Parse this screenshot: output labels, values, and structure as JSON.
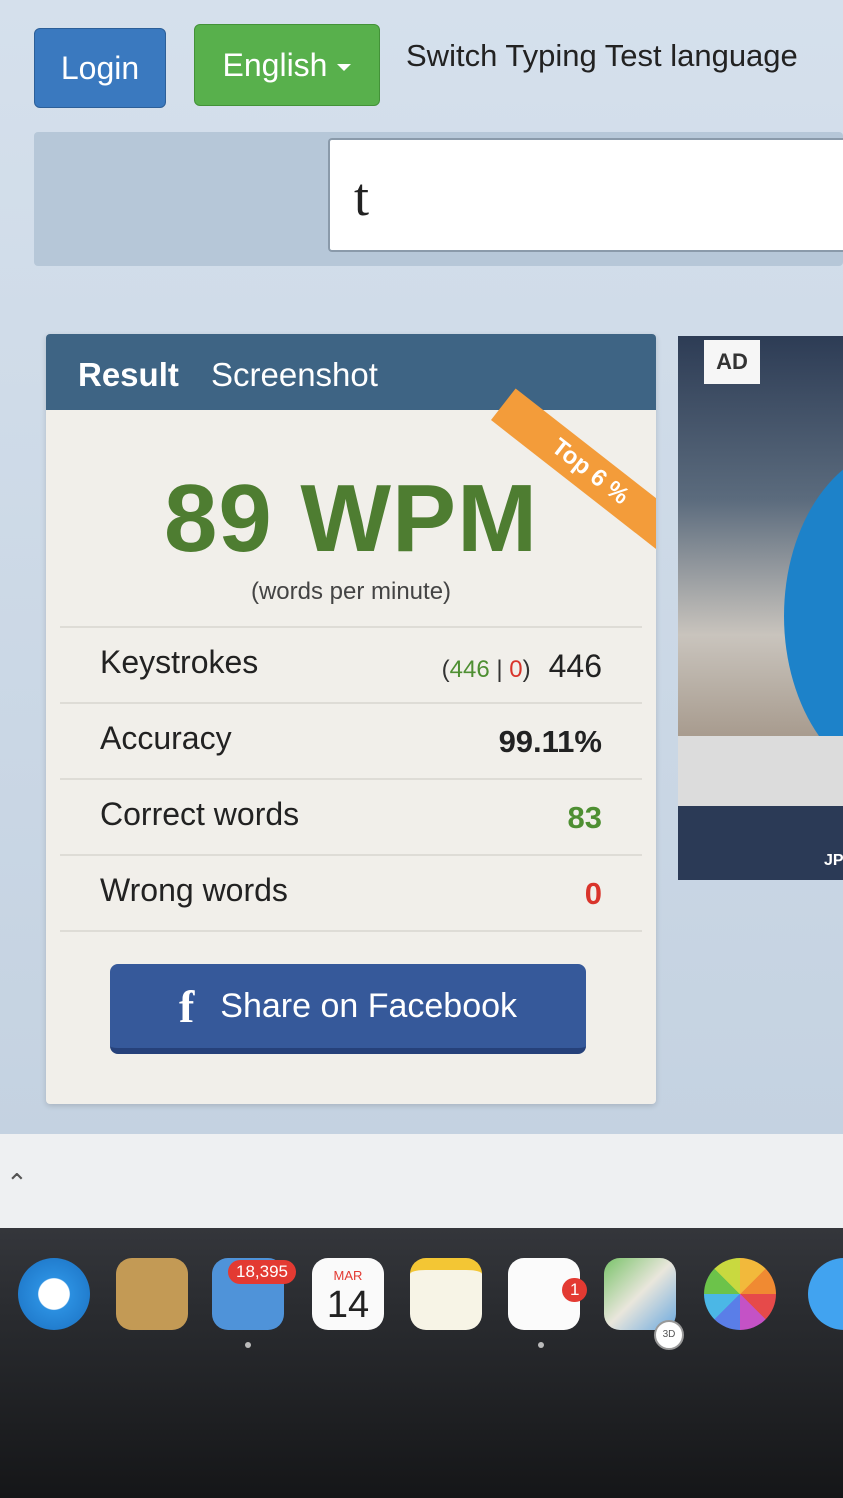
{
  "topbar": {
    "login_label": "Login",
    "language_label": "English",
    "language_hint": "Switch Typing Test language"
  },
  "typing": {
    "input_value": "t"
  },
  "result": {
    "tab_result": "Result",
    "tab_screenshot": "Screenshot",
    "ribbon": "Top 6 %",
    "wpm": "89 WPM",
    "wpm_caption": "(words per minute)",
    "keystrokes": {
      "label": "Keystrokes",
      "detail_open": "(",
      "correct": "446",
      "separator": " | ",
      "wrong": "0",
      "detail_close": ")",
      "total": "446"
    },
    "accuracy": {
      "label": "Accuracy",
      "value": "99.11%"
    },
    "correct_words": {
      "label": "Correct words",
      "value": "83"
    },
    "wrong_words": {
      "label": "Wrong words",
      "value": "0"
    },
    "share_label": "Share on Facebook",
    "share_icon": "f"
  },
  "ad": {
    "tag": "AD",
    "corner_text": "JP"
  },
  "dock": {
    "mail_badge": "18,395",
    "calendar_month": "MAR",
    "calendar_day": "14",
    "reminders_badge": "1",
    "maps_3d": "3D"
  },
  "colors": {
    "wpm_green": "#4e7d31",
    "header_blue": "#3e6484",
    "ribbon_orange": "#f39c3a",
    "facebook_blue": "#36599a"
  }
}
